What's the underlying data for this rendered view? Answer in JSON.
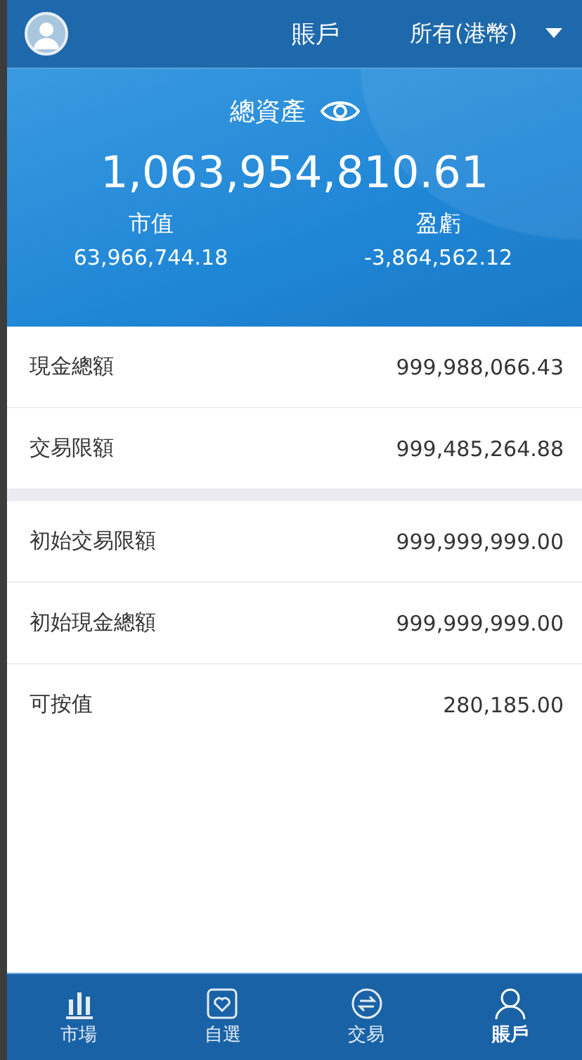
{
  "header": {
    "title": "賬戶",
    "account_filter": "所有(港幣)"
  },
  "summary": {
    "label": "總資產",
    "total": "1,063,954,810.61",
    "stats": [
      {
        "label": "市值",
        "value": "63,966,744.18"
      },
      {
        "label": "盈虧",
        "value": "-3,864,562.12"
      }
    ]
  },
  "groups": [
    [
      {
        "label": "現金總額",
        "value": "999,988,066.43"
      },
      {
        "label": "交易限額",
        "value": "999,485,264.88"
      }
    ],
    [
      {
        "label": "初始交易限額",
        "value": "999,999,999.00"
      },
      {
        "label": "初始現金總額",
        "value": "999,999,999.00"
      },
      {
        "label": "可按值",
        "value": "280,185.00"
      }
    ]
  ],
  "tabs": [
    {
      "kind": "chart",
      "label": "市場",
      "selected": false
    },
    {
      "kind": "heart",
      "label": "自選",
      "selected": false
    },
    {
      "kind": "exchange",
      "label": "交易",
      "selected": false
    },
    {
      "kind": "person",
      "label": "賬戶",
      "selected": true
    }
  ]
}
